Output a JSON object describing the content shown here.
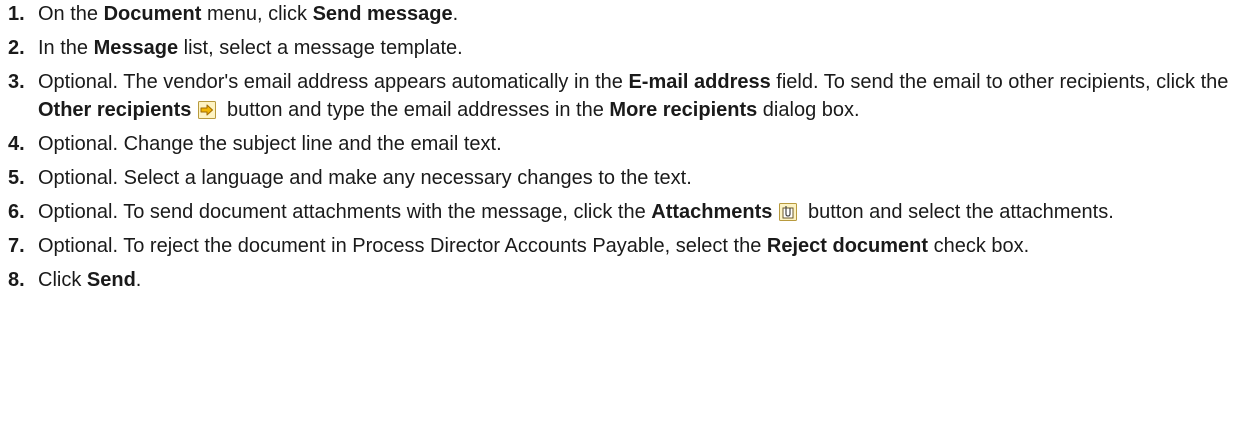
{
  "steps": [
    {
      "num": "1.",
      "parts": [
        {
          "t": "On the "
        },
        {
          "b": "Document"
        },
        {
          "t": " menu, click "
        },
        {
          "b": "Send message"
        },
        {
          "t": "."
        }
      ]
    },
    {
      "num": "2.",
      "parts": [
        {
          "t": "In the "
        },
        {
          "b": "Message"
        },
        {
          "t": " list, select a message template."
        }
      ]
    },
    {
      "num": "3.",
      "parts": [
        {
          "t": "Optional. The vendor's email address appears automatically in the "
        },
        {
          "b": "E-mail address"
        },
        {
          "t": " field. To send the email to other recipients, click the "
        },
        {
          "b": "Other recipients"
        },
        {
          "icon": "other-recipients-icon"
        },
        {
          "t": " button and type the email addresses in the "
        },
        {
          "b": "More recipients"
        },
        {
          "t": " dialog box."
        }
      ]
    },
    {
      "num": "4.",
      "parts": [
        {
          "t": "Optional. Change the subject line and the email text."
        }
      ]
    },
    {
      "num": "5.",
      "parts": [
        {
          "t": "Optional. Select a language and make any necessary changes to the text."
        }
      ]
    },
    {
      "num": "6.",
      "parts": [
        {
          "t": "Optional. To send document attachments with the message, click the "
        },
        {
          "b": "Attachments"
        },
        {
          "icon": "attachments-icon"
        },
        {
          "t": " button and select the attachments."
        }
      ]
    },
    {
      "num": "7.",
      "parts": [
        {
          "t": "Optional. To reject the document in Process Director Accounts Payable, select the "
        },
        {
          "b": "Reject document"
        },
        {
          "t": " check box."
        }
      ]
    },
    {
      "num": "8.",
      "parts": [
        {
          "t": "Click "
        },
        {
          "b": "Send"
        },
        {
          "t": "."
        }
      ]
    }
  ]
}
